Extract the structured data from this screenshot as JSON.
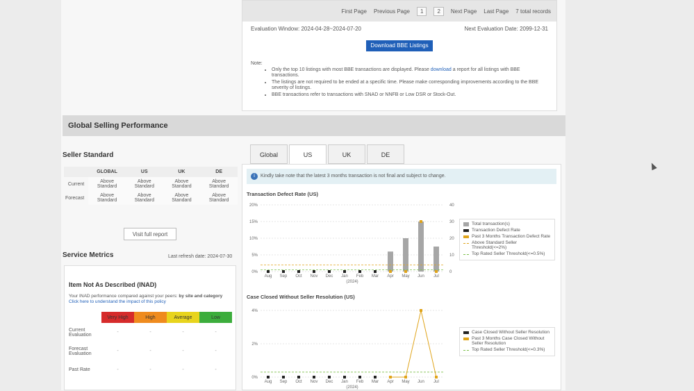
{
  "pager": {
    "first": "First Page",
    "previous": "Previous Page",
    "pages": [
      "1",
      "2"
    ],
    "next": "Next Page",
    "last": "Last Page",
    "records": "7 total records"
  },
  "evaluation": {
    "window": "Evaluation Window: 2024-04-28~2024-07-20",
    "next": "Next Evaluation Date: 2099-12-31"
  },
  "download_label": "Download BBE Listings",
  "note": {
    "label": "Note:",
    "item1_pre": "Only the top 10 listings with most BBE transactions are displayed. Please",
    "item1_link": "download",
    "item1_post": "a report for all listings with BBE transactions.",
    "item2": "The listings are not required to be ended at a specific time. Please make corresponding improvements according to the BBE severity of listings.",
    "item3": "BBE transactions refer to transactions with SNAD or NNFB or Low DSR or Stock-Out."
  },
  "section_title": "Global Selling Performance",
  "seller_standard": {
    "title": "Seller Standard",
    "columns": [
      "GLOBAL",
      "US",
      "UK",
      "DE"
    ],
    "rows": [
      {
        "label": "Current",
        "values": [
          "Above Standard",
          "Above Standard",
          "Above Standard",
          "Above Standard"
        ]
      },
      {
        "label": "Forecast",
        "values": [
          "Above Standard",
          "Above Standard",
          "Above Standard",
          "Above Standard"
        ]
      }
    ],
    "visit_label": "Visit full report"
  },
  "service_metrics": {
    "title": "Service Metrics",
    "refresh": "Last refresh date: 2024-07-30"
  },
  "inad": {
    "title": "Item Not As Described (INAD)",
    "desc_pre": "Your INAD performance compared against your peers:",
    "desc_bold": "by site and category",
    "desc_link": "Click here to understand the impact of this policy",
    "levels": [
      {
        "label": "Very High",
        "color": "#d62b2b"
      },
      {
        "label": "High",
        "color": "#ef8b1e"
      },
      {
        "label": "Average",
        "color": "#e8d41d"
      },
      {
        "label": "Low",
        "color": "#3cad3c"
      }
    ],
    "rows": [
      {
        "label": "Current Evaluation",
        "values": [
          "-",
          "-",
          "-",
          "-"
        ]
      },
      {
        "label": "Forecast Evaluation",
        "values": [
          "-",
          "-",
          "-",
          "-"
        ]
      },
      {
        "label": "Past Rate",
        "values": [
          "-",
          "-",
          "-",
          "-"
        ]
      }
    ]
  },
  "tabs": [
    "Global",
    "US",
    "UK",
    "DE"
  ],
  "active_tab": "US",
  "notice": "Kindly take note that the latest 3 months transaction is not final and subject to change.",
  "chart_data": [
    {
      "type": "bar",
      "title": "Transaction Defect Rate (US)",
      "categories": [
        "Aug",
        "Sep",
        "Oct",
        "Nov",
        "Dec",
        "Jan",
        "Feb",
        "Mar",
        "Apr",
        "May",
        "Jun",
        "Jul"
      ],
      "year_label": "(2024)",
      "y_left_ticks": [
        "0%",
        "5%",
        "10%",
        "15%",
        "20%"
      ],
      "y_right_ticks": [
        "0",
        "10",
        "20",
        "30",
        "40"
      ],
      "ylim_right": [
        0,
        40
      ],
      "ylim_left": [
        0,
        20
      ],
      "series": [
        {
          "name": "Total transaction(s)",
          "values": [
            0,
            0,
            0,
            0,
            0,
            0,
            0,
            0,
            12,
            20,
            30,
            15
          ],
          "color": "#a6a6a6"
        },
        {
          "name": "Transaction Defect Rate",
          "values": [
            0,
            0,
            0,
            0,
            0,
            0,
            0,
            0,
            null,
            null,
            null,
            null
          ],
          "color": "#222222"
        },
        {
          "name": "Past 3 Months Transaction Defect Rate",
          "values": [
            null,
            null,
            null,
            null,
            null,
            null,
            null,
            null,
            0,
            0,
            15,
            0
          ],
          "color": "#e0a41a"
        },
        {
          "name": "Above Standard Seller Threshold(<=2%)",
          "value": 2,
          "color": "#e0a41a"
        },
        {
          "name": "Top Rated Seller Threshold(<=0.5%)",
          "value": 0.5,
          "color": "#7cc04a"
        }
      ]
    },
    {
      "type": "line",
      "title": "Case Closed Without Seller Resolution (US)",
      "categories": [
        "Aug",
        "Sep",
        "Oct",
        "Nov",
        "Dec",
        "Jan",
        "Feb",
        "Mar",
        "Apr",
        "May",
        "Jun",
        "Jul"
      ],
      "year_label": "(2024)",
      "y_ticks": [
        "0%",
        "2%",
        "4%"
      ],
      "ylim": [
        0,
        4
      ],
      "series": [
        {
          "name": "Case Closed Without Seller Resolution",
          "values": [
            0,
            0,
            0,
            0,
            0,
            0,
            0,
            0,
            null,
            null,
            null,
            null
          ],
          "color": "#222222"
        },
        {
          "name": "Past 3 Months Case Closed Without Seller Resolution",
          "values": [
            null,
            null,
            null,
            null,
            null,
            null,
            null,
            null,
            0,
            0,
            4,
            0
          ],
          "color": "#e0a41a"
        },
        {
          "name": "Top Rated Seller Threshold(<=0.3%)",
          "value": 0.3,
          "color": "#7cc04a"
        }
      ]
    }
  ]
}
